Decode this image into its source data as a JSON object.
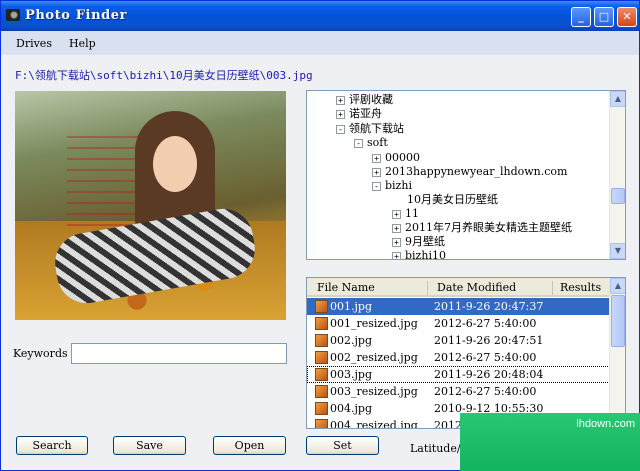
{
  "window": {
    "title": "Photo Finder"
  },
  "menu": {
    "items": [
      "Drives",
      "Help"
    ]
  },
  "path": "F:\\领航下载站\\soft\\bizhi\\10月美女日历壁纸\\003.jpg",
  "tree": {
    "items": [
      {
        "label": "评剧收藏",
        "toggle": "+"
      },
      {
        "label": "诺亚舟",
        "toggle": "+"
      },
      {
        "label": "领航下载站",
        "toggle": "-"
      },
      {
        "label": "soft",
        "toggle": "-"
      },
      {
        "label": "00000",
        "toggle": "+"
      },
      {
        "label": "2013happynewyear_lhdown.com",
        "toggle": "+"
      },
      {
        "label": "bizhi",
        "toggle": "-"
      },
      {
        "label": "10月美女日历壁纸",
        "toggle": ""
      },
      {
        "label": "11",
        "toggle": "+"
      },
      {
        "label": "2011年7月养眼美女精选主题壁纸",
        "toggle": "+"
      },
      {
        "label": "9月壁纸",
        "toggle": "+"
      },
      {
        "label": "bizhi10",
        "toggle": "+"
      }
    ]
  },
  "files": {
    "columns": [
      "File Name",
      "Date Modified",
      "Results"
    ],
    "rows": [
      {
        "name": "001.jpg",
        "date": "2011-9-26 20:47:37"
      },
      {
        "name": "001_resized.jpg",
        "date": "2012-6-27 5:40:00"
      },
      {
        "name": "002.jpg",
        "date": "2011-9-26 20:47:51"
      },
      {
        "name": "002_resized.jpg",
        "date": "2012-6-27 5:40:00"
      },
      {
        "name": "003.jpg",
        "date": "2011-9-26 20:48:04"
      },
      {
        "name": "003_resized.jpg",
        "date": "2012-6-27 5:40:00"
      },
      {
        "name": "004.jpg",
        "date": "2010-9-12 10:55:30"
      },
      {
        "name": "004_resized.jpg",
        "date": "2012-"
      }
    ],
    "selected_index": 0,
    "focused_index": 4
  },
  "keywords": {
    "label": "Keywords",
    "value": ""
  },
  "buttons": {
    "search": "Search",
    "save": "Save",
    "open": "Open",
    "set": "Set"
  },
  "latitude_label": "Latitude/",
  "watermark": "lhdown.com",
  "colors": {
    "title_bar": "#0553db",
    "selection": "#316ac5",
    "path_text": "#1a1ab0",
    "watermark": "#11b35f"
  }
}
